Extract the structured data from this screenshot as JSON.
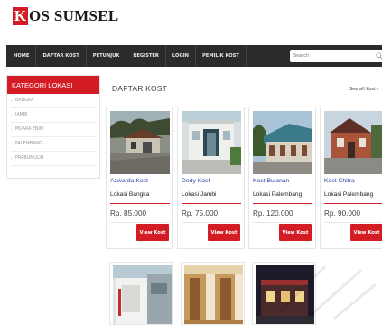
{
  "logo": {
    "letter": "K",
    "rest": "OS SUMSEL"
  },
  "nav": {
    "items": [
      "HOME",
      "DAFTAR KOST",
      "PETUNJUK",
      "REGISTER",
      "LOGIN",
      "PEMILIK KOST"
    ],
    "search_placeholder": "Search"
  },
  "sidebar": {
    "title": "KATEGORI LOKASI",
    "items": [
      "BANGKA",
      "JAMBI",
      "MUARA ENIM",
      "PALEMBANG",
      "PRABUMULIH"
    ]
  },
  "main": {
    "title": "DAFTAR KOST",
    "see_all": "See all Kost ›",
    "cards": [
      {
        "name": "Azwarda Kost",
        "location": "Lokasi Bangka",
        "price": "Rp. 85.000",
        "button": "View Kost",
        "photo": "house-photo"
      },
      {
        "name": "Dedy Kost",
        "location": "Lokasi Jambi",
        "price": "Rp. 75.000",
        "button": "View Kost",
        "photo": "white-building-photo"
      },
      {
        "name": "Kost Bulanan",
        "location": "Lokasi Palembang",
        "price": "Rp. 120.000",
        "button": "View Kost",
        "photo": "row-houses-photo"
      },
      {
        "name": "Kost Chitra",
        "location": "Lokasi Palembang",
        "price": "Rp. 90.000",
        "button": "View Kost",
        "photo": "brick-house-photo"
      }
    ]
  },
  "colors": {
    "accent": "#d41c24",
    "nav_bg": "#2b2b2b",
    "link": "#2b3fa0"
  }
}
